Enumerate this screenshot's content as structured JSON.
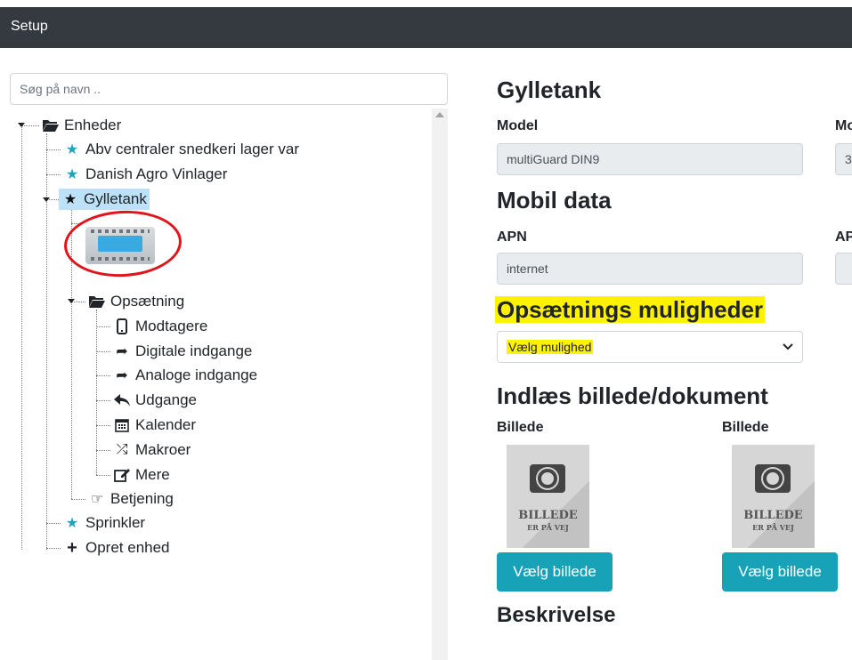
{
  "topbar": {
    "title": "Setup"
  },
  "search": {
    "placeholder": "Søg på navn .."
  },
  "tree": {
    "root": "Enheder",
    "items": [
      "Abv centraler snedkeri lager var",
      "Danish Agro Vinlager",
      "Gylletank",
      "Sprinkler",
      "Opret enhed"
    ],
    "setup_folder": "Opsætning",
    "setup_items": [
      "Modtagere",
      "Digitale indgange",
      "Analoge indgange",
      "Udgange",
      "Kalender",
      "Makroer",
      "Mere"
    ],
    "operation": "Betjening"
  },
  "form": {
    "device_title": "Gylletank",
    "model_label": "Model",
    "model_value": "multiGuard DIN9",
    "second_label_partial": "Mo",
    "second_value_partial": "3",
    "mobile_title": "Mobil data",
    "apn_label": "APN",
    "apn_value": "internet",
    "apn2_label_partial": "AP",
    "options_title": "Opsætnings muligheder",
    "options_select": "Vælg mulighed",
    "upload_title": "Indlæs billede/dokument",
    "image_label_1": "Billede",
    "image_label_2": "Billede",
    "placeholder_line1": "BILLEDE",
    "placeholder_line2": "ER PÅ VEJ",
    "choose_button_1": "Vælg billede",
    "choose_button_2": "Vælg billede",
    "description_title": "Beskrivelse"
  },
  "colors": {
    "topbar": "#343a40",
    "accent": "#17a2b8",
    "star": "#1fa3c0",
    "highlight": "#fff200",
    "annotation": "#e0151b",
    "selected_bg": "#bde1f8"
  }
}
